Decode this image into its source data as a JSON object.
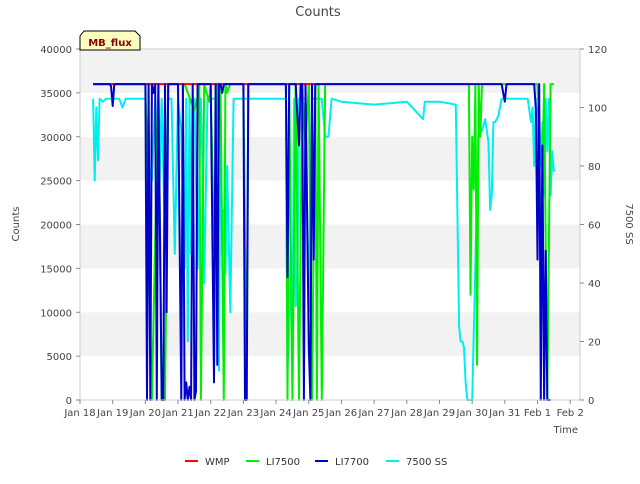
{
  "chart_data": {
    "type": "line",
    "title": "Counts",
    "xlabel": "Time",
    "ylabel": "Counts",
    "y2label": "7500 SS",
    "badge": "MB_flux",
    "xlim": [
      0,
      15.3
    ],
    "ylim": [
      0,
      40000
    ],
    "y2lim": [
      0,
      120
    ],
    "x_ticks": [
      {
        "pos": 0,
        "label": "Jan 18"
      },
      {
        "pos": 1,
        "label": "Jan 19"
      },
      {
        "pos": 2,
        "label": "Jan 20"
      },
      {
        "pos": 3,
        "label": "Jan 21"
      },
      {
        "pos": 4,
        "label": "Jan 22"
      },
      {
        "pos": 5,
        "label": "Jan 23"
      },
      {
        "pos": 6,
        "label": "Jan 24"
      },
      {
        "pos": 7,
        "label": "Jan 25"
      },
      {
        "pos": 8,
        "label": "Jan 26"
      },
      {
        "pos": 9,
        "label": "Jan 27"
      },
      {
        "pos": 10,
        "label": "Jan 28"
      },
      {
        "pos": 11,
        "label": "Jan 29"
      },
      {
        "pos": 12,
        "label": "Jan 30"
      },
      {
        "pos": 13,
        "label": "Jan 31"
      },
      {
        "pos": 14,
        "label": "Feb 1"
      },
      {
        "pos": 15,
        "label": "Feb 2"
      }
    ],
    "y_ticks": [
      0,
      5000,
      10000,
      15000,
      20000,
      25000,
      30000,
      35000,
      40000
    ],
    "y_tick_labels": [
      "0",
      "5000",
      "10000",
      "15000",
      "20000",
      "25000",
      "30000",
      "35000",
      "40000"
    ],
    "y2_ticks": [
      0,
      20,
      40,
      60,
      80,
      100,
      120
    ],
    "y2_tick_labels": [
      "0",
      "20",
      "40",
      "60",
      "80",
      "100",
      "120"
    ],
    "grid": "horizontal bands",
    "legend_position": "bottom",
    "series": [
      {
        "name": "WMP",
        "axis": "left",
        "color": "#ff0000",
        "x": [
          0.4,
          6.9,
          7.3
        ],
        "y": [
          36000,
          36000,
          36000
        ]
      },
      {
        "name": "LI7500",
        "axis": "left",
        "color": "#00ee00",
        "x": [
          0.4,
          2.0,
          2.2,
          2.4,
          2.5,
          2.6,
          2.7,
          3.2,
          3.5,
          3.6,
          3.65,
          3.7,
          3.8,
          3.95,
          4.0,
          4.1,
          4.2,
          4.3,
          4.4,
          4.45,
          4.5,
          4.6,
          5.0,
          5.1,
          5.15,
          5.5,
          6.3,
          6.35,
          6.4,
          6.5,
          6.6,
          6.7,
          6.8,
          6.9,
          7.0,
          7.1,
          7.2,
          7.25,
          7.3,
          7.4,
          7.5,
          11.9,
          11.95,
          12.0,
          12.05,
          12.1,
          12.15,
          12.2,
          12.25,
          12.3,
          12.4,
          14.0,
          14.1,
          14.2,
          14.3,
          14.4,
          14.5
        ],
        "y": [
          36000,
          36000,
          0,
          36000,
          0,
          0,
          36000,
          36000,
          33000,
          34500,
          36000,
          0,
          36000,
          34000,
          36000,
          17000,
          36000,
          35000,
          0,
          36000,
          35000,
          36000,
          36000,
          0,
          36000,
          36000,
          36000,
          0,
          36000,
          0,
          36000,
          0,
          36000,
          29000,
          36000,
          0,
          36000,
          0,
          36000,
          0,
          36000,
          36000,
          12000,
          30000,
          24000,
          36000,
          4000,
          36000,
          30000,
          36000,
          36000,
          36000,
          17000,
          36000,
          0,
          36000,
          36000
        ]
      },
      {
        "name": "LI7700",
        "axis": "left",
        "color": "#0000cc",
        "x": [
          0.4,
          0.9,
          0.95,
          1.0,
          1.05,
          1.1,
          2.0,
          2.05,
          2.1,
          2.15,
          2.2,
          2.25,
          2.3,
          2.35,
          2.4,
          2.5,
          2.55,
          2.6,
          2.65,
          2.7,
          3.0,
          3.1,
          3.15,
          3.2,
          3.25,
          3.3,
          3.35,
          3.4,
          3.45,
          3.5,
          3.55,
          3.6,
          3.7,
          4.0,
          4.1,
          4.15,
          4.2,
          4.25,
          4.3,
          4.35,
          4.4,
          5.0,
          5.05,
          5.1,
          5.15,
          5.2,
          6.3,
          6.35,
          6.4,
          6.6,
          6.7,
          6.75,
          6.8,
          6.85,
          6.9,
          7.0,
          7.05,
          7.1,
          7.15,
          7.2,
          7.3,
          12.9,
          13.0,
          13.05,
          13.1,
          13.9,
          13.95,
          14.0,
          14.05,
          14.1,
          14.15,
          14.2,
          14.25,
          14.3,
          14.35,
          14.4
        ],
        "y": [
          36000,
          36000,
          35800,
          33500,
          36000,
          36000,
          36000,
          0,
          36000,
          0,
          36000,
          35000,
          36000,
          0,
          36000,
          0,
          0,
          36000,
          10000,
          36000,
          36000,
          0,
          36000,
          0,
          2000,
          0,
          1500,
          0,
          36000,
          0,
          1000,
          36000,
          36000,
          36000,
          2000,
          36000,
          4000,
          36000,
          36000,
          35000,
          36000,
          36000,
          0,
          0,
          36000,
          36000,
          36000,
          14000,
          36000,
          36000,
          29000,
          36000,
          36000,
          0,
          36000,
          6000,
          0,
          36000,
          16000,
          36000,
          36000,
          36000,
          34000,
          36000,
          36000,
          36000,
          33000,
          16000,
          36000,
          0,
          29000,
          0,
          17000,
          0,
          0,
          0
        ]
      },
      {
        "name": "7500 SS",
        "axis": "right",
        "color": "#00eeee",
        "x": [
          0.4,
          0.45,
          0.5,
          0.55,
          0.6,
          0.7,
          0.8,
          1.0,
          1.2,
          1.3,
          1.4,
          1.6,
          1.8,
          2.0,
          2.05,
          2.1,
          2.2,
          2.3,
          2.4,
          2.5,
          2.6,
          2.7,
          2.8,
          2.9,
          3.0,
          3.1,
          3.2,
          3.25,
          3.3,
          3.35,
          3.4,
          3.45,
          3.5,
          3.6,
          3.7,
          3.75,
          3.8,
          3.9,
          4.0,
          4.1,
          4.2,
          4.25,
          4.3,
          4.35,
          4.4,
          4.45,
          4.5,
          4.55,
          4.6,
          4.7,
          4.8,
          4.9,
          5.0,
          5.2,
          5.5,
          5.8,
          6.0,
          6.3,
          6.35,
          6.4,
          6.45,
          6.5,
          6.55,
          6.6,
          6.65,
          6.7,
          6.8,
          6.9,
          7.0,
          7.1,
          7.2,
          7.3,
          7.4,
          7.5,
          7.6,
          7.7,
          8.0,
          9.0,
          10.0,
          10.5,
          10.55,
          10.6,
          10.7,
          11.0,
          11.5,
          11.6,
          11.65,
          11.7,
          11.75,
          11.8,
          11.85,
          11.9,
          12.0,
          12.2,
          12.3,
          12.4,
          12.5,
          12.55,
          12.6,
          12.65,
          12.7,
          12.8,
          12.9,
          13.0,
          13.2,
          13.5,
          13.6,
          13.7,
          13.8,
          13.85,
          13.9,
          13.95,
          14.0,
          14.05,
          14.1,
          14.15,
          14.2,
          14.25,
          14.3,
          14.35,
          14.4,
          14.45,
          14.5
        ],
        "y": [
          103,
          75,
          100,
          82,
          103,
          102,
          103,
          103,
          103,
          100,
          103,
          103,
          103,
          103,
          90,
          80,
          75,
          103,
          60,
          103,
          55,
          103,
          103,
          50,
          103,
          92,
          45,
          103,
          20,
          103,
          50,
          103,
          103,
          45,
          103,
          80,
          40,
          103,
          103,
          103,
          103,
          10,
          103,
          50,
          65,
          43,
          80,
          55,
          30,
          103,
          103,
          103,
          103,
          103,
          103,
          103,
          103,
          103,
          10,
          25,
          50,
          20,
          103,
          32,
          35,
          103,
          103,
          103,
          30,
          103,
          103,
          103,
          103,
          90,
          90,
          103,
          102,
          101,
          102,
          96,
          102,
          102,
          102,
          102,
          101,
          25,
          20,
          20,
          18,
          6,
          0,
          0,
          0,
          95,
          92,
          96,
          88,
          65,
          70,
          95,
          95,
          97,
          103,
          103,
          103,
          103,
          103,
          103,
          95,
          100,
          80,
          103,
          60,
          98,
          80,
          95,
          70,
          103,
          85,
          103,
          70,
          85,
          78
        ]
      }
    ]
  }
}
